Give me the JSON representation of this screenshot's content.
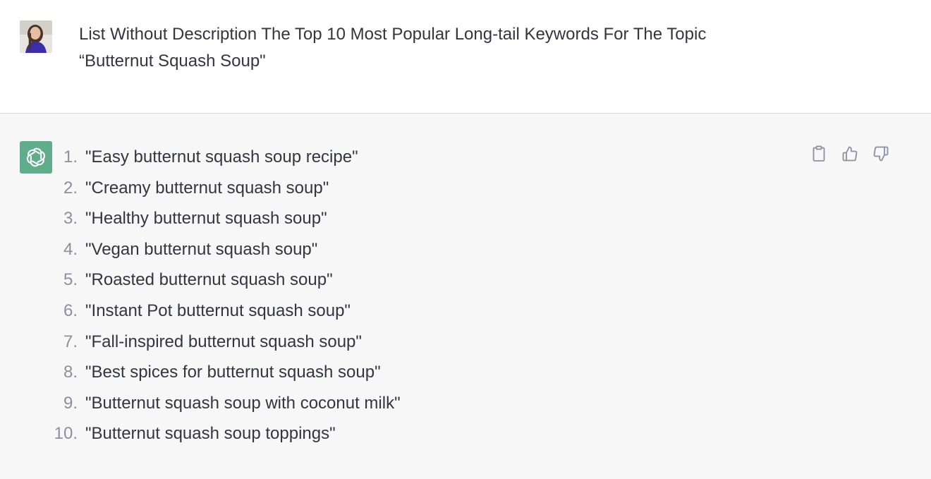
{
  "user_message": {
    "line1": "List Without Description The Top 10 Most Popular Long-tail Keywords For The Topic",
    "line2": "“Butternut Squash Soup\""
  },
  "assistant_message": {
    "items": [
      {
        "num": "1.",
        "text": "\"Easy butternut squash soup recipe\""
      },
      {
        "num": "2.",
        "text": "\"Creamy butternut squash soup\""
      },
      {
        "num": "3.",
        "text": "\"Healthy butternut squash soup\""
      },
      {
        "num": "4.",
        "text": "\"Vegan butternut squash soup\""
      },
      {
        "num": "5.",
        "text": "\"Roasted butternut squash soup\""
      },
      {
        "num": "6.",
        "text": "\"Instant Pot butternut squash soup\""
      },
      {
        "num": "7.",
        "text": "\"Fall-inspired butternut squash soup\""
      },
      {
        "num": "8.",
        "text": "\"Best spices for butternut squash soup\""
      },
      {
        "num": "9.",
        "text": "\"Butternut squash soup with coconut milk\""
      },
      {
        "num": "10.",
        "text": "\"Butternut squash soup toppings\""
      }
    ]
  },
  "icons": {
    "avatar": "user-avatar",
    "assistant": "openai-logo-icon",
    "copy": "clipboard-icon",
    "like": "thumbs-up-icon",
    "dislike": "thumbs-down-icon"
  },
  "colors": {
    "assistant_bg": "#f7f7f8",
    "user_bg": "#ffffff",
    "logo_bg": "#5fad8b",
    "text": "#343541",
    "muted": "#8e8ea0"
  }
}
